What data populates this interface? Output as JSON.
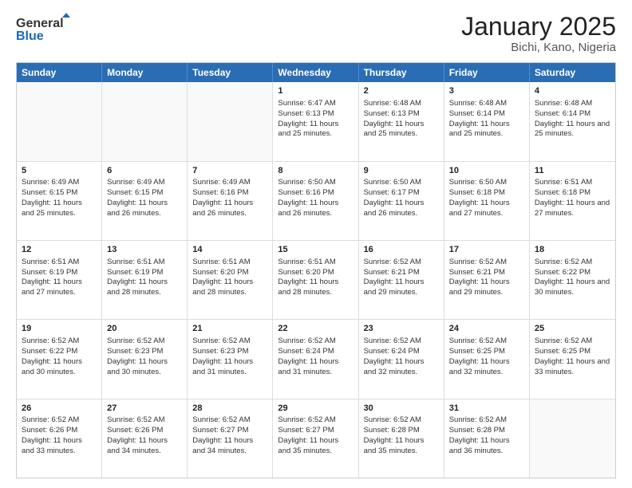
{
  "logo": {
    "text_general": "General",
    "text_blue": "Blue"
  },
  "header": {
    "month_year": "January 2025",
    "location": "Bichi, Kano, Nigeria"
  },
  "days_of_week": [
    "Sunday",
    "Monday",
    "Tuesday",
    "Wednesday",
    "Thursday",
    "Friday",
    "Saturday"
  ],
  "weeks": [
    [
      {
        "day": "",
        "sunrise": "",
        "sunset": "",
        "daylight": "",
        "empty": true
      },
      {
        "day": "",
        "sunrise": "",
        "sunset": "",
        "daylight": "",
        "empty": true
      },
      {
        "day": "",
        "sunrise": "",
        "sunset": "",
        "daylight": "",
        "empty": true
      },
      {
        "day": "1",
        "sunrise": "Sunrise: 6:47 AM",
        "sunset": "Sunset: 6:13 PM",
        "daylight": "Daylight: 11 hours and 25 minutes.",
        "empty": false
      },
      {
        "day": "2",
        "sunrise": "Sunrise: 6:48 AM",
        "sunset": "Sunset: 6:13 PM",
        "daylight": "Daylight: 11 hours and 25 minutes.",
        "empty": false
      },
      {
        "day": "3",
        "sunrise": "Sunrise: 6:48 AM",
        "sunset": "Sunset: 6:14 PM",
        "daylight": "Daylight: 11 hours and 25 minutes.",
        "empty": false
      },
      {
        "day": "4",
        "sunrise": "Sunrise: 6:48 AM",
        "sunset": "Sunset: 6:14 PM",
        "daylight": "Daylight: 11 hours and 25 minutes.",
        "empty": false
      }
    ],
    [
      {
        "day": "5",
        "sunrise": "Sunrise: 6:49 AM",
        "sunset": "Sunset: 6:15 PM",
        "daylight": "Daylight: 11 hours and 25 minutes.",
        "empty": false
      },
      {
        "day": "6",
        "sunrise": "Sunrise: 6:49 AM",
        "sunset": "Sunset: 6:15 PM",
        "daylight": "Daylight: 11 hours and 26 minutes.",
        "empty": false
      },
      {
        "day": "7",
        "sunrise": "Sunrise: 6:49 AM",
        "sunset": "Sunset: 6:16 PM",
        "daylight": "Daylight: 11 hours and 26 minutes.",
        "empty": false
      },
      {
        "day": "8",
        "sunrise": "Sunrise: 6:50 AM",
        "sunset": "Sunset: 6:16 PM",
        "daylight": "Daylight: 11 hours and 26 minutes.",
        "empty": false
      },
      {
        "day": "9",
        "sunrise": "Sunrise: 6:50 AM",
        "sunset": "Sunset: 6:17 PM",
        "daylight": "Daylight: 11 hours and 26 minutes.",
        "empty": false
      },
      {
        "day": "10",
        "sunrise": "Sunrise: 6:50 AM",
        "sunset": "Sunset: 6:18 PM",
        "daylight": "Daylight: 11 hours and 27 minutes.",
        "empty": false
      },
      {
        "day": "11",
        "sunrise": "Sunrise: 6:51 AM",
        "sunset": "Sunset: 6:18 PM",
        "daylight": "Daylight: 11 hours and 27 minutes.",
        "empty": false
      }
    ],
    [
      {
        "day": "12",
        "sunrise": "Sunrise: 6:51 AM",
        "sunset": "Sunset: 6:19 PM",
        "daylight": "Daylight: 11 hours and 27 minutes.",
        "empty": false
      },
      {
        "day": "13",
        "sunrise": "Sunrise: 6:51 AM",
        "sunset": "Sunset: 6:19 PM",
        "daylight": "Daylight: 11 hours and 28 minutes.",
        "empty": false
      },
      {
        "day": "14",
        "sunrise": "Sunrise: 6:51 AM",
        "sunset": "Sunset: 6:20 PM",
        "daylight": "Daylight: 11 hours and 28 minutes.",
        "empty": false
      },
      {
        "day": "15",
        "sunrise": "Sunrise: 6:51 AM",
        "sunset": "Sunset: 6:20 PM",
        "daylight": "Daylight: 11 hours and 28 minutes.",
        "empty": false
      },
      {
        "day": "16",
        "sunrise": "Sunrise: 6:52 AM",
        "sunset": "Sunset: 6:21 PM",
        "daylight": "Daylight: 11 hours and 29 minutes.",
        "empty": false
      },
      {
        "day": "17",
        "sunrise": "Sunrise: 6:52 AM",
        "sunset": "Sunset: 6:21 PM",
        "daylight": "Daylight: 11 hours and 29 minutes.",
        "empty": false
      },
      {
        "day": "18",
        "sunrise": "Sunrise: 6:52 AM",
        "sunset": "Sunset: 6:22 PM",
        "daylight": "Daylight: 11 hours and 30 minutes.",
        "empty": false
      }
    ],
    [
      {
        "day": "19",
        "sunrise": "Sunrise: 6:52 AM",
        "sunset": "Sunset: 6:22 PM",
        "daylight": "Daylight: 11 hours and 30 minutes.",
        "empty": false
      },
      {
        "day": "20",
        "sunrise": "Sunrise: 6:52 AM",
        "sunset": "Sunset: 6:23 PM",
        "daylight": "Daylight: 11 hours and 30 minutes.",
        "empty": false
      },
      {
        "day": "21",
        "sunrise": "Sunrise: 6:52 AM",
        "sunset": "Sunset: 6:23 PM",
        "daylight": "Daylight: 11 hours and 31 minutes.",
        "empty": false
      },
      {
        "day": "22",
        "sunrise": "Sunrise: 6:52 AM",
        "sunset": "Sunset: 6:24 PM",
        "daylight": "Daylight: 11 hours and 31 minutes.",
        "empty": false
      },
      {
        "day": "23",
        "sunrise": "Sunrise: 6:52 AM",
        "sunset": "Sunset: 6:24 PM",
        "daylight": "Daylight: 11 hours and 32 minutes.",
        "empty": false
      },
      {
        "day": "24",
        "sunrise": "Sunrise: 6:52 AM",
        "sunset": "Sunset: 6:25 PM",
        "daylight": "Daylight: 11 hours and 32 minutes.",
        "empty": false
      },
      {
        "day": "25",
        "sunrise": "Sunrise: 6:52 AM",
        "sunset": "Sunset: 6:25 PM",
        "daylight": "Daylight: 11 hours and 33 minutes.",
        "empty": false
      }
    ],
    [
      {
        "day": "26",
        "sunrise": "Sunrise: 6:52 AM",
        "sunset": "Sunset: 6:26 PM",
        "daylight": "Daylight: 11 hours and 33 minutes.",
        "empty": false
      },
      {
        "day": "27",
        "sunrise": "Sunrise: 6:52 AM",
        "sunset": "Sunset: 6:26 PM",
        "daylight": "Daylight: 11 hours and 34 minutes.",
        "empty": false
      },
      {
        "day": "28",
        "sunrise": "Sunrise: 6:52 AM",
        "sunset": "Sunset: 6:27 PM",
        "daylight": "Daylight: 11 hours and 34 minutes.",
        "empty": false
      },
      {
        "day": "29",
        "sunrise": "Sunrise: 6:52 AM",
        "sunset": "Sunset: 6:27 PM",
        "daylight": "Daylight: 11 hours and 35 minutes.",
        "empty": false
      },
      {
        "day": "30",
        "sunrise": "Sunrise: 6:52 AM",
        "sunset": "Sunset: 6:28 PM",
        "daylight": "Daylight: 11 hours and 35 minutes.",
        "empty": false
      },
      {
        "day": "31",
        "sunrise": "Sunrise: 6:52 AM",
        "sunset": "Sunset: 6:28 PM",
        "daylight": "Daylight: 11 hours and 36 minutes.",
        "empty": false
      },
      {
        "day": "",
        "sunrise": "",
        "sunset": "",
        "daylight": "",
        "empty": true
      }
    ]
  ]
}
